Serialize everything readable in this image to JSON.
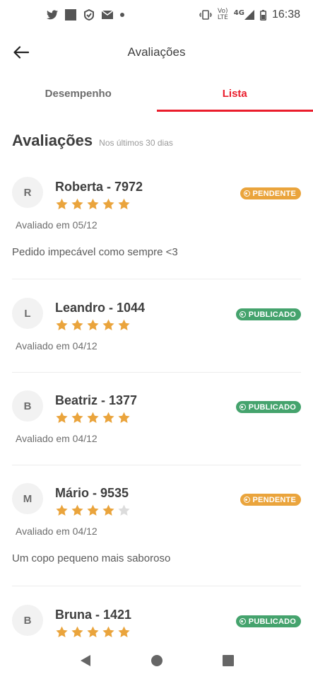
{
  "status_bar": {
    "network_label_top": "Vo)",
    "network_label_bottom": "LTE",
    "network_type": "4G",
    "time": "16:38",
    "icons": [
      "twitter-icon",
      "app-square-icon",
      "checkmark-badge-icon",
      "mail-icon",
      "notification-dot-icon",
      "vibrate-icon",
      "signal-icon",
      "battery-icon"
    ]
  },
  "header": {
    "title": "Avaliações",
    "back_icon": "arrow-left-icon"
  },
  "tabs": [
    {
      "label": "Desempenho",
      "active": false
    },
    {
      "label": "Lista",
      "active": true
    }
  ],
  "section": {
    "title": "Avaliações",
    "subtitle": "Nos últimos 30 dias"
  },
  "colors": {
    "accent": "#ea1d2c",
    "star": "#eaa43c",
    "star_empty": "#dcdcdc",
    "pending": "#eaa43c",
    "published": "#45a36d"
  },
  "reviews": [
    {
      "initial": "R",
      "name": "Roberta - 7972",
      "rating": 5,
      "status": "PENDENTE",
      "status_type": "pending",
      "date": "Avaliado em 05/12",
      "comment": "Pedido impecável como sempre <3"
    },
    {
      "initial": "L",
      "name": "Leandro - 1044",
      "rating": 5,
      "status": "PUBLICADO",
      "status_type": "published",
      "date": "Avaliado em 04/12",
      "comment": ""
    },
    {
      "initial": "B",
      "name": "Beatriz - 1377",
      "rating": 5,
      "status": "PUBLICADO",
      "status_type": "published",
      "date": "Avaliado em 04/12",
      "comment": ""
    },
    {
      "initial": "M",
      "name": "Mário - 9535",
      "rating": 4,
      "status": "PENDENTE",
      "status_type": "pending",
      "date": "Avaliado em 04/12",
      "comment": "Um copo pequeno mais saboroso"
    },
    {
      "initial": "B",
      "name": "Bruna - 1421",
      "rating": 5,
      "status": "PUBLICADO",
      "status_type": "published",
      "date": "",
      "comment": ""
    }
  ],
  "nav_bar": {
    "icons": [
      "back-triangle-icon",
      "home-circle-icon",
      "recents-square-icon"
    ]
  }
}
